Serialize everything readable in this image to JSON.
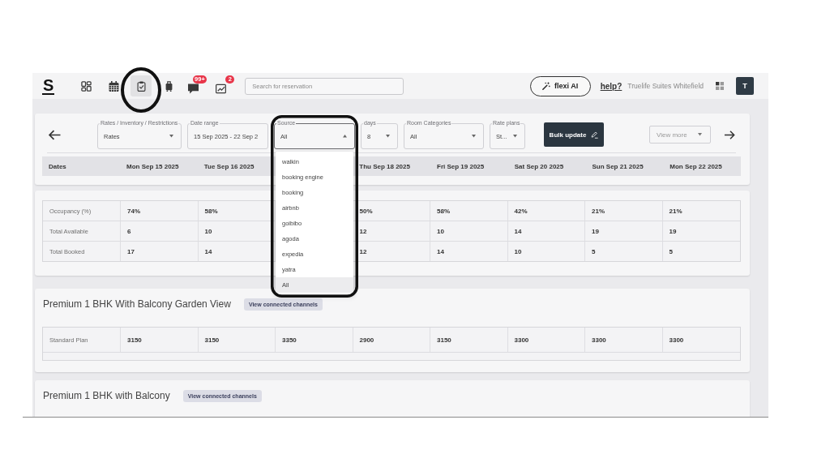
{
  "top_bar": {
    "logo": "S",
    "nav_items": [
      {
        "kind": "dashboard",
        "selected": false,
        "annotated": false
      },
      {
        "kind": "calendar",
        "selected": false,
        "annotated": false
      },
      {
        "kind": "clipboard",
        "selected": true,
        "annotated": true
      },
      {
        "kind": "luggage",
        "selected": false,
        "annotated": false
      },
      {
        "kind": "chat",
        "selected": false,
        "annotated": false,
        "badge": "99+"
      },
      {
        "kind": "chart",
        "selected": false,
        "annotated": false,
        "badge": "2"
      }
    ],
    "search": {
      "placeholder": "Search for reservation"
    },
    "ai_button": "flexi AI",
    "help_link": "help?",
    "property_name": "Truelife Suites Whitefield",
    "avatar": "T"
  },
  "filters": [
    {
      "kind": "select",
      "label": "Rates / Inventory / Restrictions",
      "value": "Rates",
      "expanded": false,
      "annotated": false
    },
    {
      "kind": "date",
      "label": "Date range",
      "value": "15 Sep 2025 - 22 Sep 2",
      "expanded": false,
      "annotated": false
    },
    {
      "kind": "select",
      "label": "Source",
      "value": "All",
      "expanded": true,
      "annotated": true,
      "options": [
        {
          "label": "walkin",
          "selected": false
        },
        {
          "label": "booking engine",
          "selected": false
        },
        {
          "label": "booking",
          "selected": false
        },
        {
          "label": "airbnb",
          "selected": false
        },
        {
          "label": "goibibo",
          "selected": false
        },
        {
          "label": "agoda",
          "selected": false
        },
        {
          "label": "expedia",
          "selected": false
        },
        {
          "label": "yatra",
          "selected": false
        },
        {
          "label": "All",
          "selected": true
        }
      ]
    },
    {
      "kind": "select",
      "label": "days",
      "value": "8",
      "expanded": false,
      "annotated": false
    },
    {
      "kind": "select",
      "label": "Room Categories",
      "value": "All",
      "expanded": false,
      "annotated": false
    },
    {
      "kind": "select",
      "label": "Rate plans",
      "value": "St...",
      "expanded": false,
      "annotated": false
    }
  ],
  "bulk_update_button": "Bulk update",
  "view_more": {
    "placeholder": "View more"
  },
  "dates_table": {
    "header": "Dates",
    "columns": [
      "Mon Sep 15 2025",
      "Tue Sep 16 2025",
      "Thu Sep 18 2025",
      "Fri Sep 19 2025",
      "Sat Sep 20 2025",
      "Sun Sep 21 2025",
      "Mon Sep 22 2025"
    ]
  },
  "stats": [
    {
      "label": "Occupancy (%)",
      "values": [
        "74%",
        "58%",
        "50%",
        "58%",
        "42%",
        "21%",
        "21%"
      ]
    },
    {
      "label": "Total Available",
      "values": [
        "6",
        "10",
        "12",
        "10",
        "14",
        "19",
        "19"
      ]
    },
    {
      "label": "Total Booked",
      "values": [
        "17",
        "14",
        "12",
        "14",
        "10",
        "5",
        "5"
      ]
    }
  ],
  "rooms": [
    {
      "name": "Premium 1 BHK With Balcony Garden View",
      "channels_button": "View connected channels",
      "plans": [
        {
          "name": "Standard Plan",
          "values": [
            "3150",
            "3150",
            "3350",
            "2900",
            "3150",
            "3300",
            "3300",
            "3300"
          ]
        }
      ]
    },
    {
      "name": "Premium 1 BHK with Balcony",
      "channels_button": "View connected channels"
    }
  ]
}
